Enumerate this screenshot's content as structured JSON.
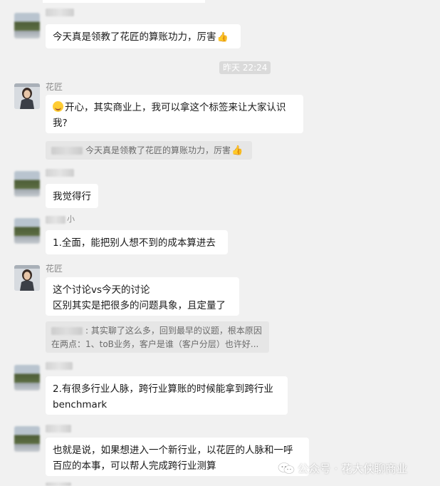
{
  "messages": [
    {
      "text": "今天真是领教了花匠的算账功力，厉害",
      "trail_icon": "thumbs-up-icon"
    },
    {
      "time": "昨天 22:24"
    },
    {
      "sender": "花匠",
      "lead_icon": "smile-emoji-icon",
      "text": "开心，其实商业上，我可以拿这个标签来让大家认识我?",
      "quote": {
        "text": "今天真是领教了花匠的算账功力，厉害",
        "trail_icon": "thumbs-up-icon"
      }
    },
    {
      "text": "我觉得行"
    },
    {
      "sender_suffix": "小",
      "text": "1.全面，能把别人想不到的成本算进去"
    },
    {
      "sender": "花匠",
      "line1": "这个讨论vs今天的讨论",
      "line2": "区别其实是把很多的问题具象，且定量了",
      "quote": {
        "line1": ": 其实聊了这么多，回到最早的议题，根本原因",
        "line2": "在两点：1、toB业务，客户是谁（客户分层）也许好..."
      }
    },
    {
      "line1": "2.有很多行业人脉，跨行业算账的时候能拿到跨行业",
      "line2": "benchmark"
    },
    {
      "line1": "也就是说，如果想进入一个新行业，以花匠的人脉和一呼",
      "line2": "百应的本事，可以帮人完成跨行业测算"
    }
  ],
  "watermark": {
    "text": "公众号 · 花大侠聊商业",
    "icon": "wechat-icon"
  }
}
